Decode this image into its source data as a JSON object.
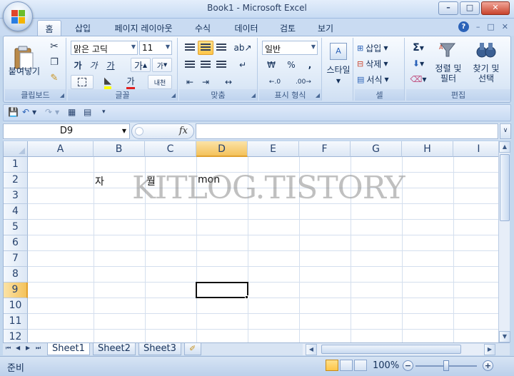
{
  "window": {
    "title": "Book1 - Microsoft Excel"
  },
  "ribbon_tabs": [
    "홈",
    "삽입",
    "페이지 레이아웃",
    "수식",
    "데이터",
    "검토",
    "보기"
  ],
  "clipboard": {
    "paste_label": "붙여넣기",
    "group_label": "클립보드"
  },
  "font": {
    "name": "맑은 고딕",
    "size": "11",
    "group_label": "글꼴",
    "bold": "가",
    "italic": "가",
    "underline": "가",
    "grow": "가",
    "shrink": "가",
    "color_glyph": "가",
    "phonetic": "내천"
  },
  "alignment": {
    "group_label": "맞춤"
  },
  "number": {
    "format": "일반",
    "currency": "₩",
    "percent": "%",
    "comma": ",",
    "group_label": "표시 형식"
  },
  "styles": {
    "label": "스타일"
  },
  "cells": {
    "insert": "삽입",
    "delete": "삭제",
    "format": "서식",
    "group_label": "셀"
  },
  "editing": {
    "sum": "Σ",
    "sort": "정렬 및",
    "sort2": "필터",
    "find": "찾기 및",
    "find2": "선택",
    "group_label": "편집"
  },
  "formula_bar": {
    "name_box": "D9",
    "fx": "fx",
    "value": ""
  },
  "columns": [
    "A",
    "B",
    "C",
    "D",
    "E",
    "F",
    "G",
    "H",
    "I"
  ],
  "rows": [
    "1",
    "2",
    "3",
    "4",
    "5",
    "6",
    "7",
    "8",
    "9",
    "10",
    "11",
    "12"
  ],
  "cells_data": {
    "B2": "자",
    "C2": "월",
    "D2": "mon"
  },
  "watermark": "KITLOG.TISTORY",
  "sheets": [
    "Sheet1",
    "Sheet2",
    "Sheet3"
  ],
  "status": {
    "ready": "준비",
    "zoom": "100%"
  },
  "colors": {
    "accent": "#2a62b8",
    "selection": "#f4c25b"
  }
}
